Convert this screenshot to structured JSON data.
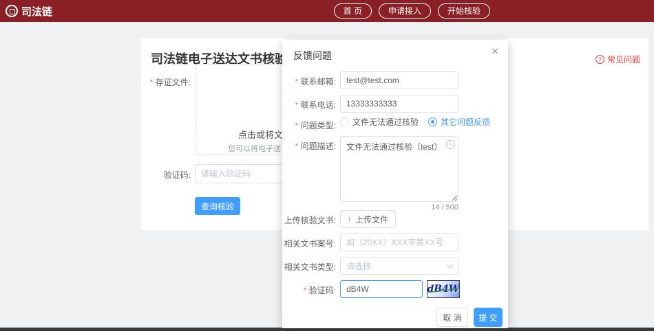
{
  "header": {
    "logo": "司法链",
    "nav": [
      {
        "label": "首 页"
      },
      {
        "label": "申请接入"
      },
      {
        "label": "开始核验"
      }
    ]
  },
  "page": {
    "title": "司法链电子送达文书核验",
    "faq": "常见问题",
    "form": {
      "file_label": "存证文件:",
      "upload_title": "点击或将文",
      "upload_hint": "您可以将电子送",
      "captcha_label": "验证码:",
      "captcha_placeholder": "请输入验证码",
      "query_button": "查询核验"
    }
  },
  "modal": {
    "title": "反馈问题",
    "email": {
      "label": "联系邮箱:",
      "value": "test@test.com"
    },
    "phone": {
      "label": "联系电话:",
      "value": "13333333333"
    },
    "issue_type": {
      "label": "问题类型:",
      "options": [
        {
          "label": "文件无法通过核验",
          "selected": false
        },
        {
          "label": "其它问题反馈",
          "selected": true
        }
      ]
    },
    "description": {
      "label": "问题描述:",
      "value": "文件无法通过核验（test）",
      "counter": "14 / 500"
    },
    "upload": {
      "label": "上传核验文书:",
      "button": "上传文件"
    },
    "case_no": {
      "label": "相关文书案号:",
      "placeholder": "如（20XX）XXX字第XX号"
    },
    "doc_type": {
      "label": "相关文书类型:",
      "placeholder": "请选择"
    },
    "captcha": {
      "label": "验证码:",
      "value": "dB4W",
      "image_text": "dB4W"
    },
    "footer": {
      "cancel": "取 消",
      "submit": "提 交"
    }
  },
  "icons": {
    "close": "×",
    "clear": "×",
    "upload": "↑",
    "question": "?"
  },
  "colors": {
    "header_bg": "#8a2025",
    "primary": "#409eff",
    "faq": "#e23c3c"
  }
}
